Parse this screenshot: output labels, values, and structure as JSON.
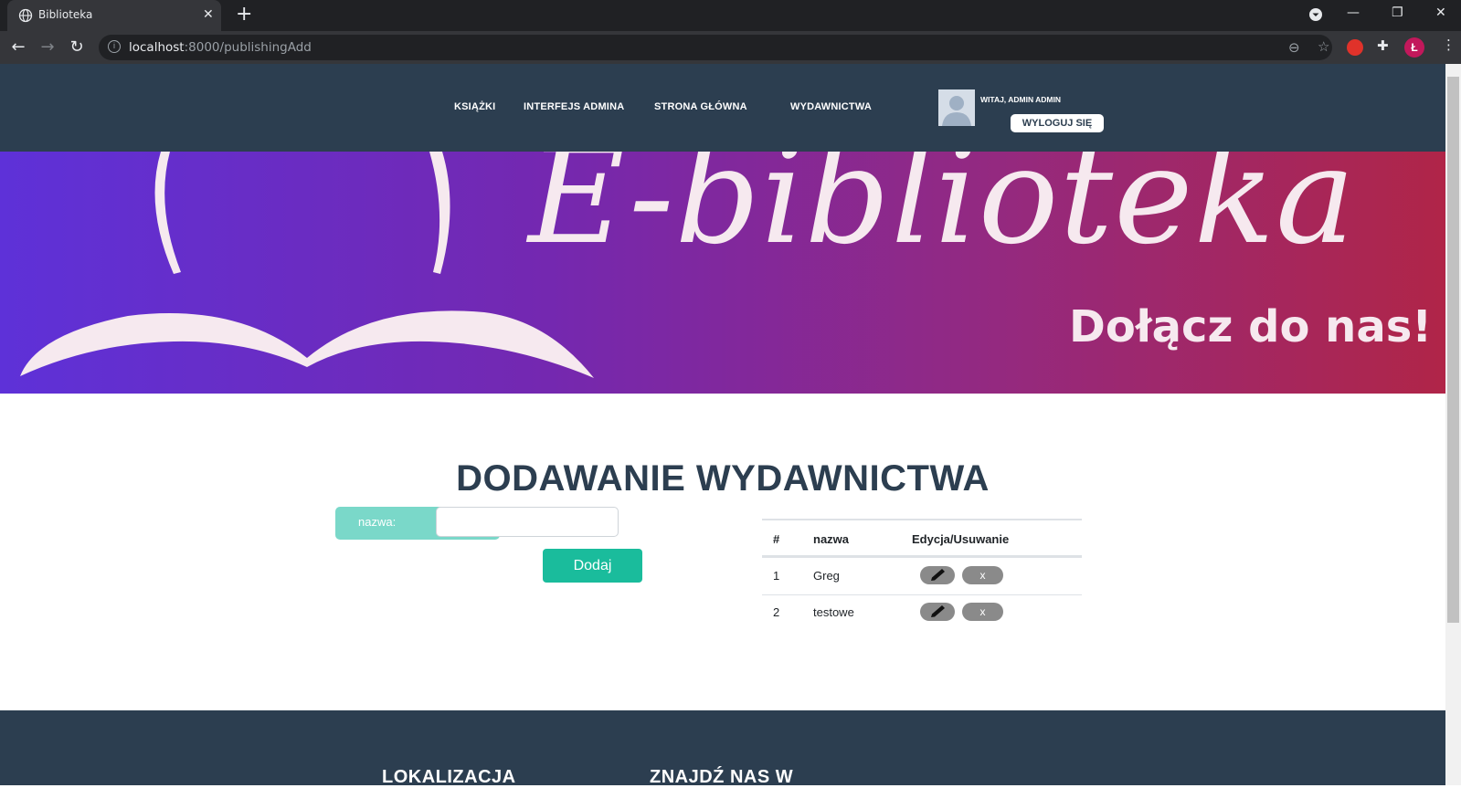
{
  "browser": {
    "tab_title": "Biblioteka",
    "tab_close": "✕",
    "new_tab": "+",
    "url_host": "localhost",
    "url_rest": ":8000/publishingAdd",
    "profile_initial": "Ł",
    "window_controls": {
      "minimize": "—",
      "restore": "❐",
      "close": "✕"
    }
  },
  "nav": {
    "links": [
      "KSIĄŻKI",
      "INTERFEJS ADMINA",
      "STRONA GŁÓWNA",
      "WYDAWNICTWA"
    ],
    "welcome": "WITAJ, ADMIN ADMIN",
    "logout": "WYLOGUJ SIĘ"
  },
  "banner": {
    "title": "E-biblioteka",
    "subtitle": "Dołącz do nas!"
  },
  "main": {
    "title": "DODAWANIE WYDAWNICTWA",
    "form": {
      "label": "nazwa:",
      "value": "",
      "submit": "Dodaj"
    },
    "table": {
      "headers": [
        "#",
        "nazwa",
        "Edycja/Usuwanie"
      ],
      "rows": [
        {
          "id": "1",
          "name": "Greg",
          "delete": "x"
        },
        {
          "id": "2",
          "name": "testowe",
          "delete": "x"
        }
      ]
    }
  },
  "footer": {
    "headings": [
      "LOKALIZACJA",
      "ZNAJDŹ NAS W"
    ]
  },
  "colors": {
    "nav_bg": "#2c3e50",
    "accent": "#1abc9c",
    "label_bg": "#7ad8c9",
    "banner_start": "#5e31d8",
    "banner_end": "#b02548"
  }
}
